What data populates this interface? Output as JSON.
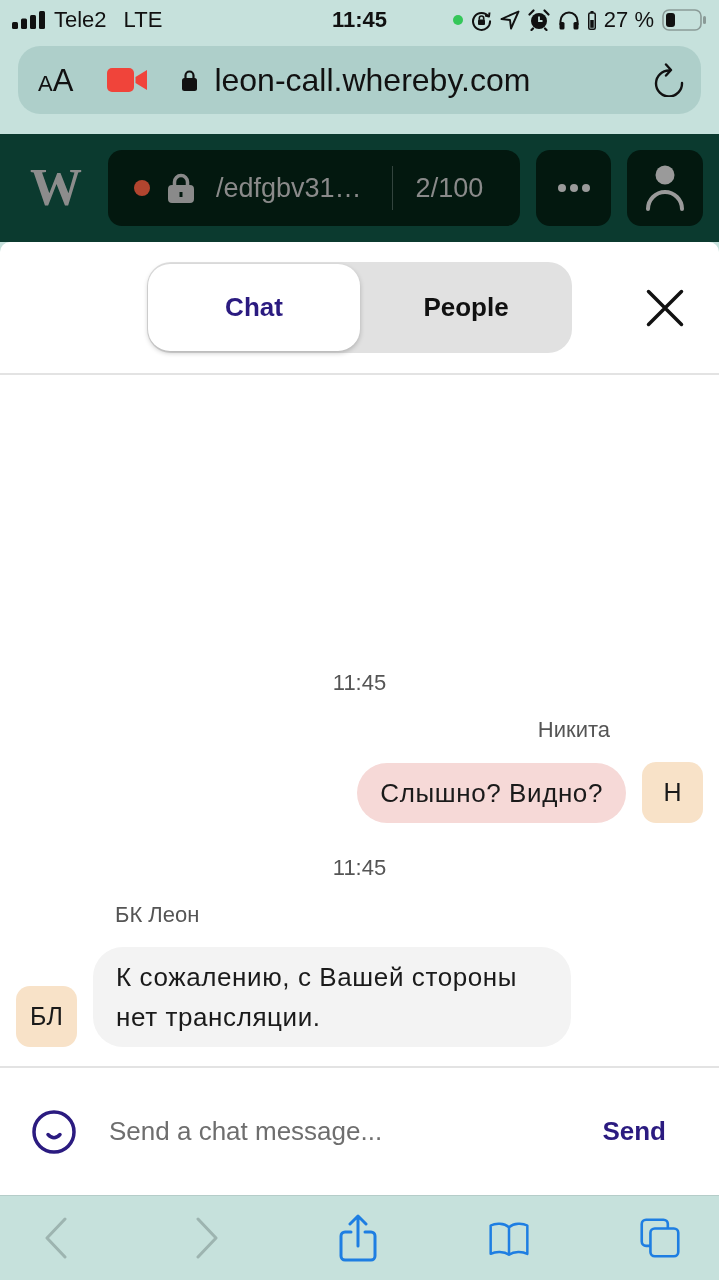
{
  "status_bar": {
    "carrier": "Tele2",
    "network": "LTE",
    "time": "11:45",
    "battery": "27 %"
  },
  "browser_bar": {
    "text_size_button": [
      "A",
      "A"
    ],
    "url": "leon-call.whereby.com"
  },
  "room_header": {
    "logo": "W",
    "room_name": "/edfgbv31…",
    "participants": "2/100"
  },
  "tabs": [
    {
      "label": "Chat",
      "selected": true
    },
    {
      "label": "People",
      "selected": false
    }
  ],
  "messages": [
    {
      "timestamp": "11:45",
      "sender": "Никита",
      "text": "Слышно? Видно?",
      "initials": "Н",
      "own": true
    },
    {
      "timestamp": "11:45",
      "sender": "БК Леон",
      "text": "К сожалению, с Вашей стороны нет трансляции.",
      "initials": "БЛ",
      "own": false
    }
  ],
  "composer": {
    "placeholder": "Send a chat message...",
    "send_label": "Send"
  },
  "browser_toolbar": [
    {
      "kind": "back",
      "disabled": true
    },
    {
      "kind": "forward",
      "disabled": true
    },
    {
      "kind": "share",
      "disabled": false
    },
    {
      "kind": "bookmarks",
      "disabled": false
    },
    {
      "kind": "tabs",
      "disabled": false
    }
  ]
}
